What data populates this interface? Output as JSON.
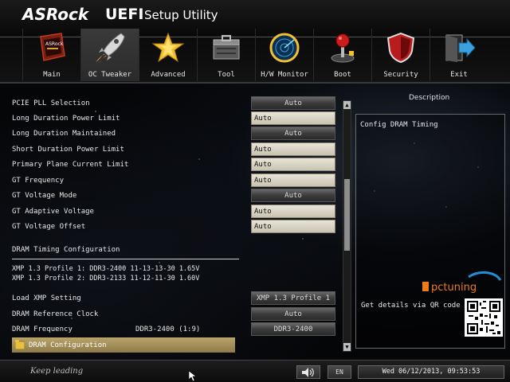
{
  "header": {
    "brand": "ASRock",
    "title_bold": "UEFI",
    "title_rest": "Setup Utility"
  },
  "tabs": [
    {
      "label": "Main",
      "icon": "main-icon",
      "active": false
    },
    {
      "label": "OC Tweaker",
      "icon": "rocket-icon",
      "active": true
    },
    {
      "label": "Advanced",
      "icon": "star-icon",
      "active": false
    },
    {
      "label": "Tool",
      "icon": "toolbox-icon",
      "active": false
    },
    {
      "label": "H/W Monitor",
      "icon": "radar-icon",
      "active": false
    },
    {
      "label": "Boot",
      "icon": "joystick-icon",
      "active": false
    },
    {
      "label": "Security",
      "icon": "shield-icon",
      "active": false
    },
    {
      "label": "Exit",
      "icon": "exit-icon",
      "active": false
    }
  ],
  "settings": [
    {
      "label": "PCIE PLL Selection",
      "value": "Auto",
      "kind": "button"
    },
    {
      "label": "Long Duration Power Limit",
      "value": "Auto",
      "kind": "input"
    },
    {
      "label": "Long Duration Maintained",
      "value": "Auto",
      "kind": "button"
    },
    {
      "label": "Short Duration Power Limit",
      "value": "Auto",
      "kind": "input"
    },
    {
      "label": "Primary Plane Current Limit",
      "value": "Auto",
      "kind": "input"
    },
    {
      "label": "GT Frequency",
      "value": "Auto",
      "kind": "input"
    },
    {
      "label": "GT Voltage Mode",
      "value": "Auto",
      "kind": "button"
    },
    {
      "label": "GT Adaptive Voltage",
      "value": "Auto",
      "kind": "input"
    },
    {
      "label": "GT Voltage Offset",
      "value": "Auto",
      "kind": "input"
    }
  ],
  "dram": {
    "section_title": "DRAM Timing Configuration",
    "xmp_profile_1": "XMP 1.3 Profile 1: DDR3-2400 11-13-13-30 1.65V",
    "xmp_profile_2": "XMP 1.3 Profile 2: DDR3-2133 11-12-11-30 1.60V",
    "load_xmp_label": "Load XMP Setting",
    "load_xmp_value": "XMP 1.3 Profile 1",
    "ref_clock_label": "DRAM Reference Clock",
    "ref_clock_value": "Auto",
    "freq_label": "DRAM Frequency",
    "freq_current": "DDR3-2400 (1:9)",
    "freq_value": "DDR3-2400",
    "config_label": "DRAM Configuration"
  },
  "description": {
    "title": "Description",
    "text": "Config DRAM Timing",
    "qr_text": "Get details via QR code",
    "watermark": "pctuning"
  },
  "footer": {
    "slogan": "Keep leading",
    "language": "EN",
    "datetime": "Wed 06/12/2013, 09:53:53"
  },
  "colors": {
    "accent_gold": "#b9a46a",
    "input_bg": "#d9d3c0",
    "watermark_orange": "#f07a1a",
    "watermark_blue": "#1f8fd6"
  }
}
